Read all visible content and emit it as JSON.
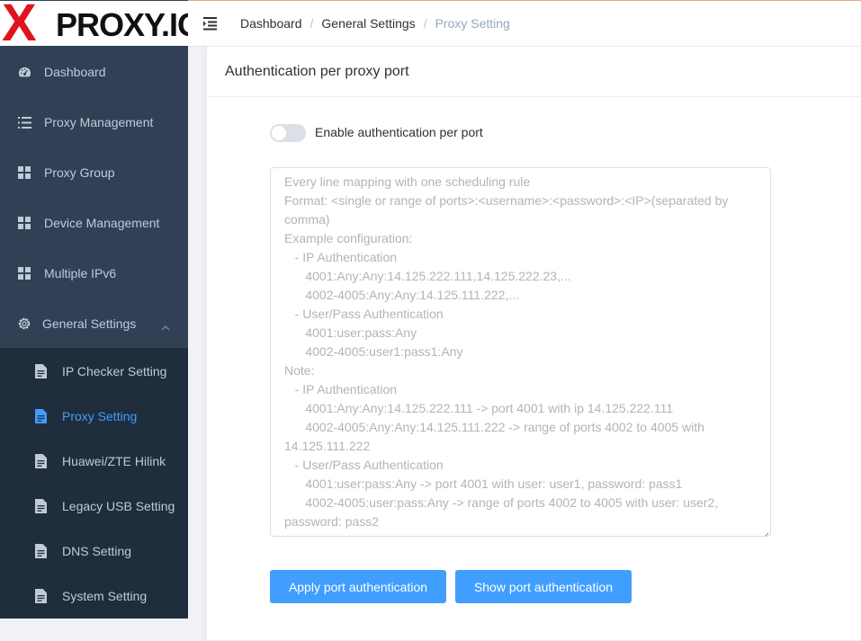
{
  "brand": {
    "logo_letter": "X",
    "logo_text": "PROXY.IO"
  },
  "sidebar": {
    "items": [
      {
        "label": "Dashboard",
        "icon": "dashboard-icon"
      },
      {
        "label": "Proxy Management",
        "icon": "list-icon"
      },
      {
        "label": "Proxy Group",
        "icon": "grid-icon"
      },
      {
        "label": "Device Management",
        "icon": "grid-icon"
      },
      {
        "label": "Multiple IPv6",
        "icon": "grid-icon"
      },
      {
        "label": "General Settings",
        "icon": "gear-icon",
        "expanded": true
      }
    ],
    "sub_items": [
      {
        "label": "IP Checker Setting",
        "icon": "document-icon"
      },
      {
        "label": "Proxy Setting",
        "icon": "document-icon",
        "active": true
      },
      {
        "label": "Huawei/ZTE Hilink",
        "icon": "document-icon"
      },
      {
        "label": "Legacy USB Setting",
        "icon": "document-icon"
      },
      {
        "label": "DNS Setting",
        "icon": "document-icon"
      },
      {
        "label": "System Setting",
        "icon": "document-icon"
      }
    ]
  },
  "breadcrumb": [
    "Dashboard",
    "General Settings",
    "Proxy Setting"
  ],
  "card": {
    "title": "Authentication per proxy port",
    "toggle_label": "Enable authentication per port",
    "toggle_on": false,
    "textarea_value": "",
    "textarea_placeholder": "Every line mapping with one scheduling rule\nFormat: <single or range of ports>:<username>:<password>:<IP>(separated by comma)\nExample configuration:\n   - IP Authentication\n      4001:Any:Any:14.125.222.111,14.125.222.23,...\n      4002-4005:Any:Any:14.125.111.222,...\n   - User/Pass Authentication\n      4001:user:pass:Any\n      4002-4005:user1:pass1:Any\nNote:\n   - IP Authentication\n      4001:Any:Any:14.125.222.111 -> port 4001 with ip 14.125.222.111\n      4002-4005:Any:Any:14.125.111.222 -> range of ports 4002 to 4005 with 14.125.111.222\n   - User/Pass Authentication\n      4001:user:pass:Any -> port 4001 with user: user1, password: pass1\n      4002-4005:user:pass:Any -> range of ports 4002 to 4005 with user: user2, password: pass2",
    "apply_button": "Apply port authentication",
    "show_button": "Show port authentication"
  },
  "colors": {
    "sidebar_bg": "#304156",
    "submenu_bg": "#1f2d3d",
    "active_text": "#409eff",
    "button_primary": "#409eff",
    "logo_red": "#e0141e"
  }
}
